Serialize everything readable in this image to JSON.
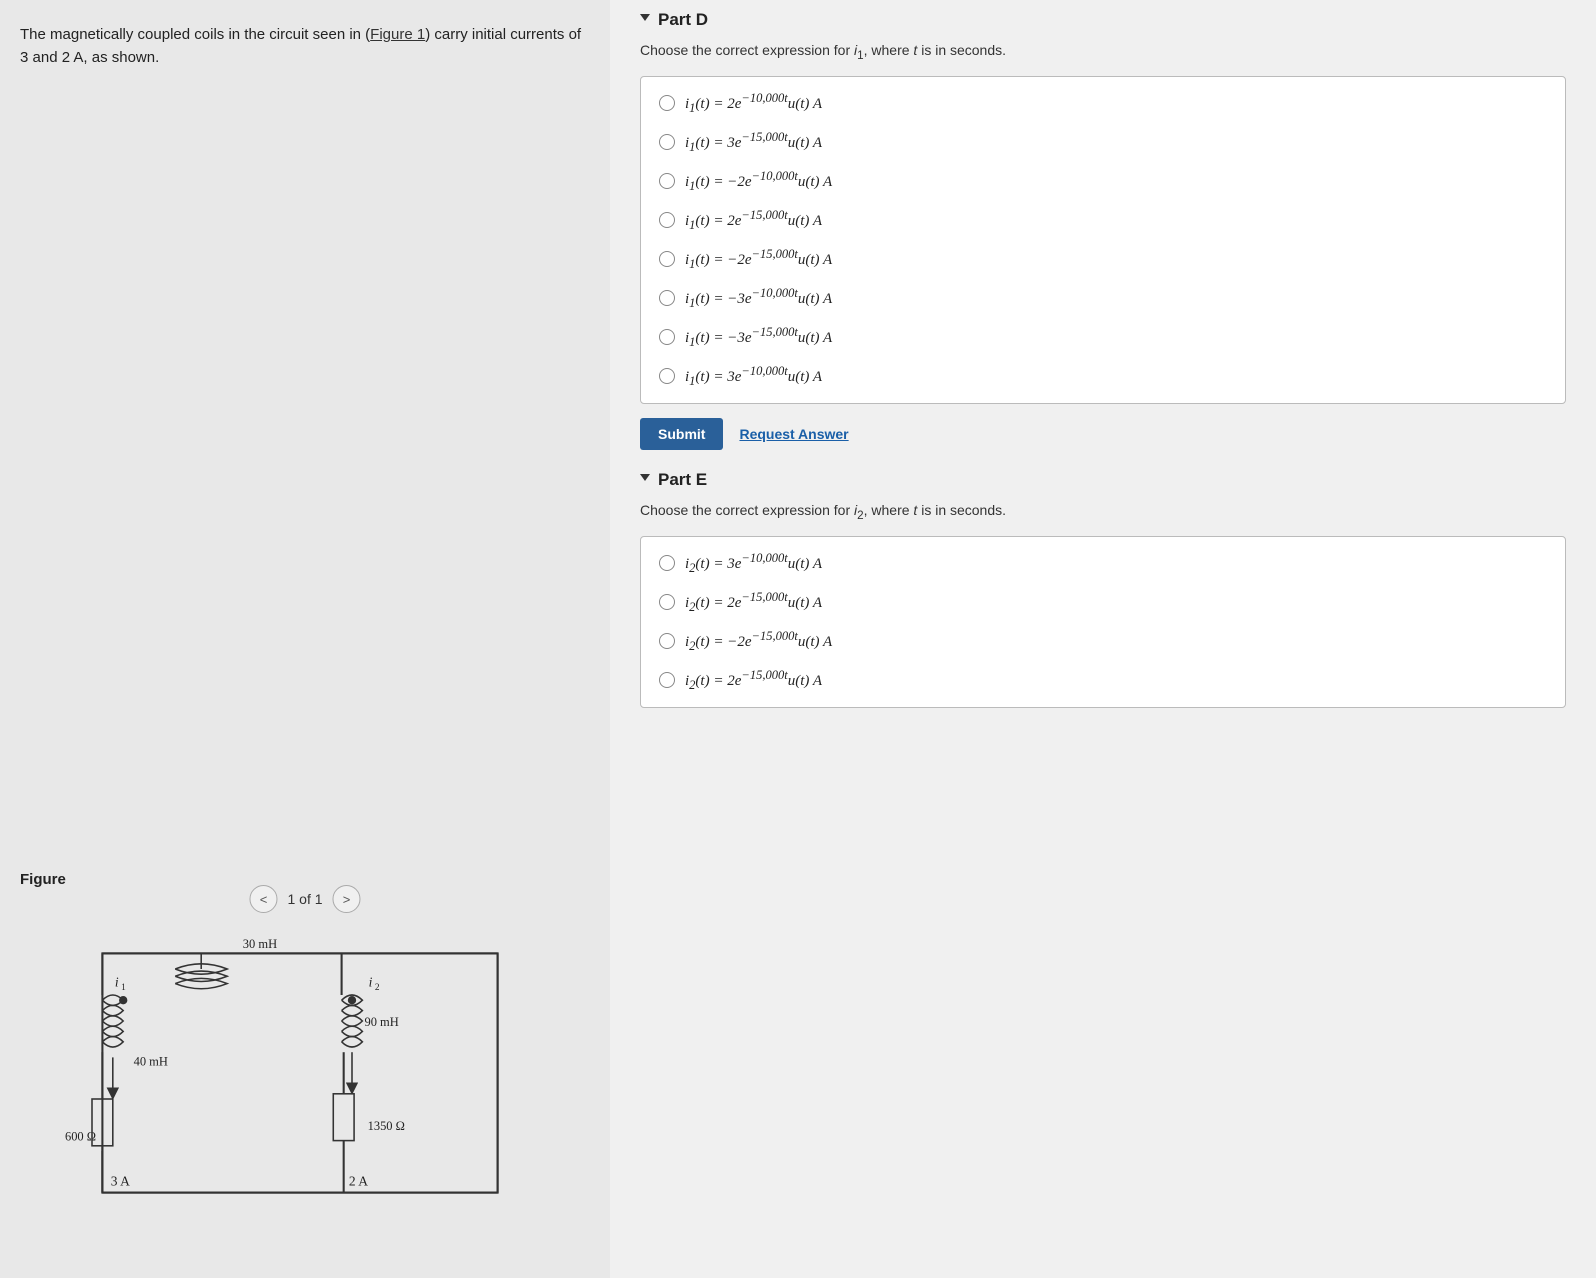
{
  "left": {
    "problem_text": "The magnetically coupled coils in the circuit seen in (Figure 1) carry initial currents of 3 and 2 A, as shown.",
    "figure_link": "Figure 1",
    "figure_label": "Figure",
    "nav_counter": "1 of 1",
    "nav_prev": "<",
    "nav_next": ">"
  },
  "right": {
    "partD": {
      "title": "Part D",
      "instruction": "Choose the correct expression for i₁, where t is in seconds.",
      "choices": [
        "i₁(t) = 2e⁻¹⁰'⁰⁰⁰ᵗ u(t) A",
        "i₁(t) = 3e⁻¹⁵'⁰⁰⁰ᵗ u(t) A",
        "i₁(t) = −2e⁻¹⁰'⁰⁰⁰ᵗ u(t) A",
        "i₁(t) = 2e⁻¹⁵'⁰⁰⁰ᵗ u(t) A",
        "i₁(t) = −2e⁻¹⁵'⁰⁰⁰ᵗ u(t) A",
        "i₁(t) = −3e⁻¹⁰'⁰⁰⁰ᵗ u(t) A",
        "i₁(t) = −3e⁻¹⁵'⁰⁰⁰ᵗ u(t) A",
        "i₁(t) = 3e⁻¹⁰'⁰⁰⁰ᵗ u(t) A"
      ],
      "submit_label": "Submit",
      "request_label": "Request Answer"
    },
    "partE": {
      "title": "Part E",
      "instruction": "Choose the correct expression for i₂, where t is in seconds.",
      "choices": [
        "i₂(t) = 3e⁻¹⁰'⁰⁰⁰ᵗ u(t) A",
        "i₂(t) = 2e⁻¹⁵'⁰⁰⁰ᵗ u(t) A",
        "i₂(t) = −2e⁻¹⁵'⁰⁰⁰ᵗ u(t) A",
        "i₂(t) = 2e⁻¹⁵'⁰⁰⁰ᵗ u(t) A"
      ]
    }
  }
}
